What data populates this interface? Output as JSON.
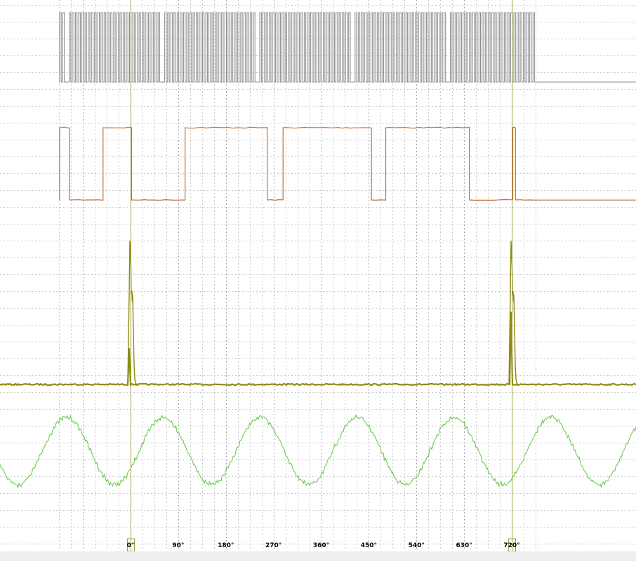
{
  "chart_data": {
    "type": "line",
    "description_of_axis": "crank angle, degrees",
    "x_range": [
      -135,
      765
    ],
    "tick_labels": [
      "0°",
      "90°",
      "180°",
      "270°",
      "360°",
      "450°",
      "540°",
      "630°",
      "720°"
    ],
    "tick_values": [
      0,
      90,
      180,
      270,
      360,
      450,
      540,
      630,
      720
    ],
    "cursors": [
      {
        "label": "0°",
        "x": 0
      },
      {
        "label": "720°",
        "x": 720
      }
    ],
    "grid": true,
    "legend": "none",
    "series": [
      {
        "kind": "crank-sensor-square-wave",
        "color": "#8c8c8c",
        "level_low": 0,
        "level_high": 1,
        "tooth_pitch_deg": 6,
        "missing_tooth_gaps_at_deg": [
          -122,
          57,
          237,
          417,
          597
        ]
      },
      {
        "kind": "cam-sensor-digital",
        "color": "#c0703a",
        "level_low": 0,
        "level_high": 1,
        "low_intervals_deg": [
          [
            -115,
            -80
          ],
          [
            -70,
            -52
          ],
          [
            2,
            90
          ],
          [
            97,
            103
          ],
          [
            258,
            288
          ],
          [
            455,
            482
          ],
          [
            640,
            722
          ],
          [
            727,
            762
          ]
        ],
        "high_intervals_deg": [
          [
            -134,
            -115
          ],
          [
            -52,
            2
          ],
          [
            103,
            258
          ],
          [
            288,
            455
          ],
          [
            482,
            640
          ],
          [
            722,
            727
          ]
        ]
      },
      {
        "kind": "ignition-pulse",
        "color": "#8c8c10",
        "baseline": 0,
        "peak": 1,
        "pulses_at_deg": [
          0,
          720
        ]
      },
      {
        "kind": "sine-like-sensor",
        "color": "#5cc83c",
        "period_deg": 183,
        "peaks_at_deg": [
          -118,
          62,
          245,
          420,
          598
        ],
        "troughs_at_deg": [
          -25,
          153,
          338,
          505,
          690
        ]
      }
    ]
  }
}
